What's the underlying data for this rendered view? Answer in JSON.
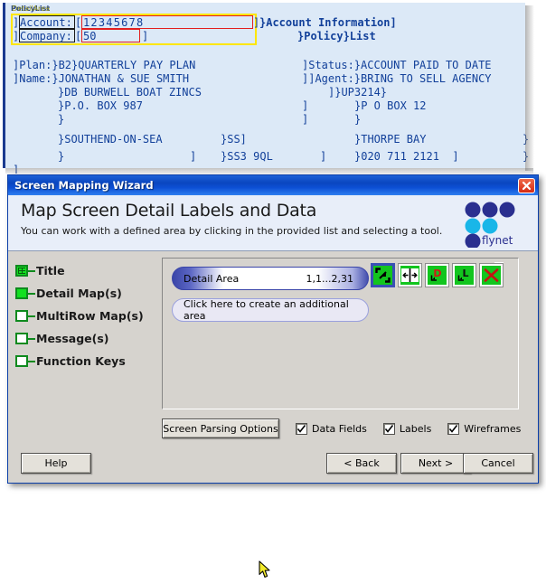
{
  "terminal": {
    "area_tags": {
      "policy_list": "PolicyList",
      "detail_area": "DetailArea"
    },
    "lines": {
      "l1_left": "]",
      "l1_label_account": "Account:",
      "l1_bracket_open": "[",
      "l1_value_account": "12345678",
      "l1_bracket_close": "]",
      "l1_right": "}Account Information]",
      "l2_left": "]",
      "l2_label_company": "Company:",
      "l2_bracket_open": "[",
      "l2_value_company": "50",
      "l2_bracket_close": "]",
      "l2_right": "}Policy}List",
      "l4_left": "]Plan:}B2}QUARTERLY PAY PLAN",
      "l4_right": "]Status:}ACCOUNT PAID TO DATE",
      "l5_left": "]Name:}JONATHAN & SUE SMITH",
      "l5_right": "]]Agent:}BRING TO SELL AGENCY",
      "l6_left": "}DB BURWELL BOAT ZINCS",
      "l6_right": "]}UP3214}",
      "l7_left": "}P.O. BOX 987",
      "l7_mid": "]",
      "l7_right": "}P O BOX 12",
      "l8_left": "}",
      "l8_mid": "]",
      "l8_right": "}",
      "l9_left": "}SOUTHEND-ON-SEA",
      "l9_mid": "}SS]",
      "l9_right": "}THORPE BAY",
      "l9_far": "}",
      "l10_left": "}",
      "l10_b": "]",
      "l10_mid": "}SS3 9QL",
      "l10_c": "]",
      "l10_right": "}020 711 2121  ]",
      "l10_far": "}",
      "l11_left": "]"
    }
  },
  "dialog": {
    "title": "Screen Mapping Wizard",
    "close_icon": "close-icon",
    "header": {
      "heading": "Map Screen Detail Labels and Data",
      "subtitle": "You can work with a defined area by clicking in the provided list and selecting a tool.",
      "brand": "flynet"
    },
    "stages": [
      {
        "label": "Title",
        "icon": "title-map-icon",
        "state": "pattern"
      },
      {
        "label": "Detail Map(s)",
        "icon": "detail-map-icon",
        "state": "filled"
      },
      {
        "label": "MultiRow Map(s)",
        "icon": "multirow-map-icon",
        "state": "empty"
      },
      {
        "label": "Message(s)",
        "icon": "message-map-icon",
        "state": "empty"
      },
      {
        "label": "Function Keys",
        "icon": "function-keys-icon",
        "state": "empty"
      }
    ],
    "areas": [
      {
        "name": "Detail Area",
        "coords": "1,1...2,31",
        "delete_icon": "delete-area-icon"
      }
    ],
    "create_area_label": "Click here to create an additional area",
    "tools": [
      {
        "name": "select-area-tool",
        "glyph": "select",
        "selected": true
      },
      {
        "name": "resize-area-tool",
        "glyph": "resize",
        "selected": false
      },
      {
        "name": "data-field-tool",
        "glyph": "D",
        "selected": false
      },
      {
        "name": "label-tool",
        "glyph": "L",
        "selected": false
      },
      {
        "name": "delete-tool",
        "glyph": "X",
        "selected": false
      }
    ],
    "options": {
      "screen_parsing_button": "Screen Parsing Options",
      "checkboxes": [
        {
          "label": "Data Fields",
          "checked": true
        },
        {
          "label": "Labels",
          "checked": true
        },
        {
          "label": "Wireframes",
          "checked": true
        }
      ]
    },
    "footer": {
      "help": "Help",
      "back": "< Back",
      "next": "Next >",
      "cancel": "Cancel"
    }
  },
  "colors": {
    "titlebar_blue": "#0a46c0",
    "terminal_bg": "#dce9f7",
    "terminal_text": "#12409a",
    "wireframe_area": "#ffe600",
    "wireframe_label": "#1a1a1a",
    "wireframe_data": "#e21f1f",
    "tool_green": "#12c51e",
    "dialog_face": "#d6d3ce"
  }
}
